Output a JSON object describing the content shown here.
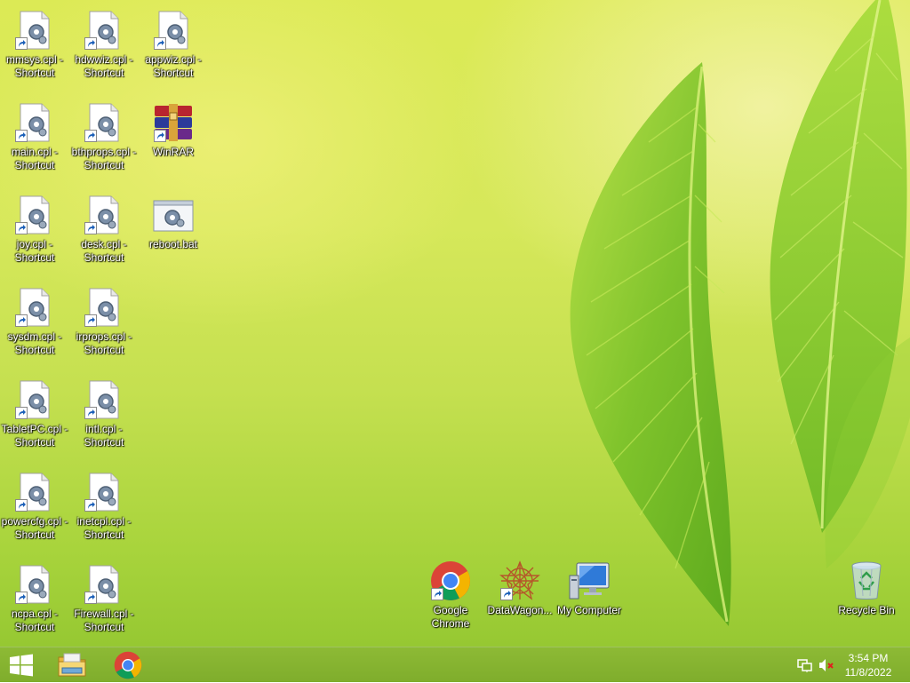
{
  "desktop": {
    "icons": [
      {
        "label": "mmsys.cpl - Shortcut",
        "kind": "cpl-shortcut"
      },
      {
        "label": "hdwwiz.cpl - Shortcut",
        "kind": "cpl-shortcut"
      },
      {
        "label": "appwiz.cpl - Shortcut",
        "kind": "cpl-shortcut"
      },
      {
        "label": "main.cpl - Shortcut",
        "kind": "cpl-shortcut"
      },
      {
        "label": "bthprops.cpl - Shortcut",
        "kind": "cpl-shortcut"
      },
      {
        "label": "WinRAR",
        "kind": "winrar-shortcut"
      },
      {
        "label": "joy.cpl - Shortcut",
        "kind": "cpl-shortcut"
      },
      {
        "label": "desk.cpl - Shortcut",
        "kind": "cpl-shortcut"
      },
      {
        "label": "reboot.bat",
        "kind": "bat-file"
      },
      {
        "label": "sysdm.cpl - Shortcut",
        "kind": "cpl-shortcut"
      },
      {
        "label": "irprops.cpl - Shortcut",
        "kind": "cpl-shortcut"
      },
      {
        "label": "TabletPC.cpl - Shortcut",
        "kind": "cpl-shortcut"
      },
      {
        "label": "intl.cpl - Shortcut",
        "kind": "cpl-shortcut"
      },
      {
        "label": "powercfg.cpl - Shortcut",
        "kind": "cpl-shortcut"
      },
      {
        "label": "inetcpl.cpl - Shortcut",
        "kind": "cpl-shortcut"
      },
      {
        "label": "ncpa.cpl - Shortcut",
        "kind": "cpl-shortcut"
      },
      {
        "label": "Firewall.cpl - Shortcut",
        "kind": "cpl-shortcut"
      },
      {
        "label": "Google Chrome",
        "kind": "chrome-shortcut"
      },
      {
        "label": "DataWagon...",
        "kind": "datawagon-shortcut"
      },
      {
        "label": "My Computer",
        "kind": "computer"
      },
      {
        "label": "Recycle Bin",
        "kind": "recycle-bin"
      }
    ]
  },
  "taskbar": {
    "start_icon": "windows-logo-icon",
    "pinned": [
      {
        "name": "file-explorer",
        "icon": "folder-icon"
      },
      {
        "name": "google-chrome",
        "icon": "chrome-icon"
      }
    ],
    "tray": {
      "network_icon": "network-icon",
      "volume_icon": "volume-muted-icon",
      "time": "3:54 PM",
      "date": "11/8/2022"
    }
  },
  "colors": {
    "taskbar": "#8dba35",
    "wallpaper_leaf": "#7cc22a",
    "chrome_red": "#db4437",
    "chrome_green": "#0f9d58",
    "chrome_yellow": "#f4b400",
    "chrome_blue": "#4285f4"
  }
}
